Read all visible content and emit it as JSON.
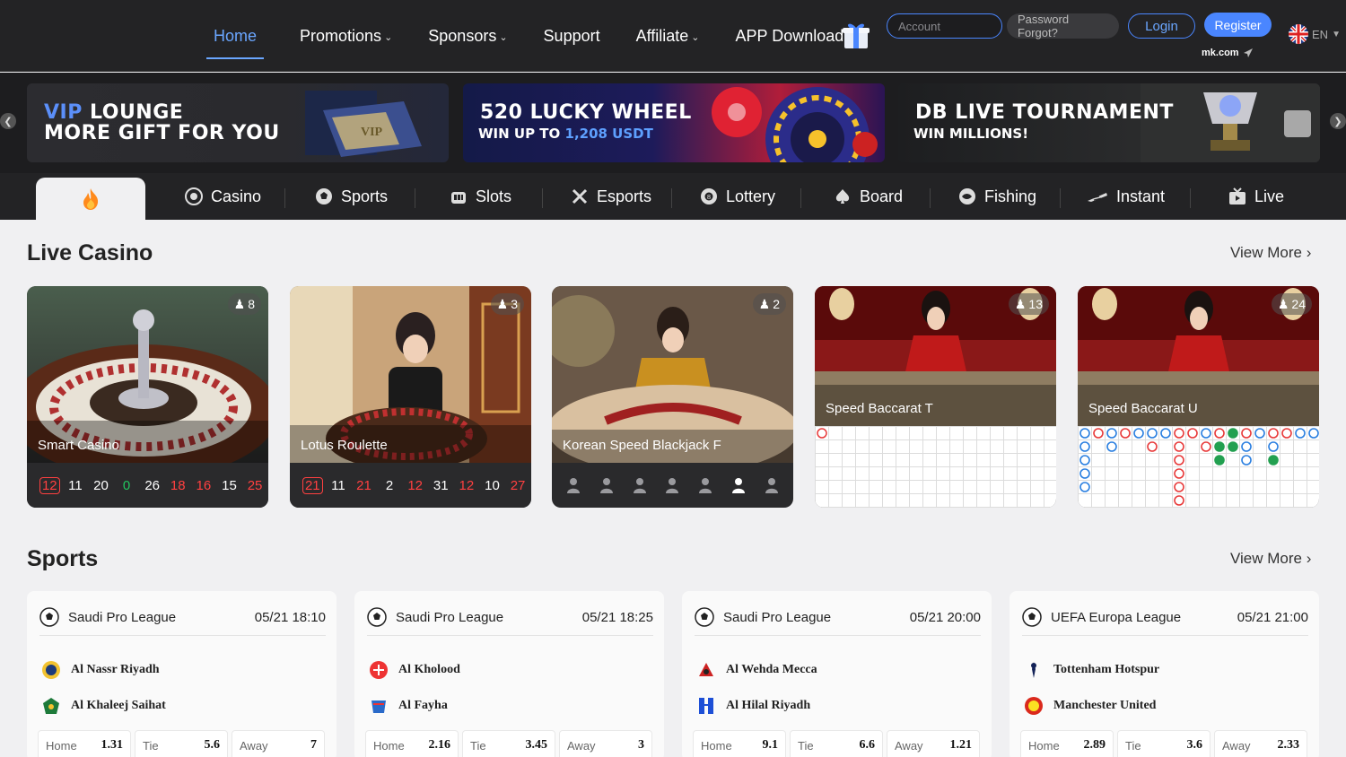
{
  "header": {
    "nav": [
      {
        "label": "Home",
        "active": true,
        "dropdown": false
      },
      {
        "label": "Promotions",
        "dropdown": true
      },
      {
        "label": "Sponsors",
        "dropdown": true
      },
      {
        "label": "Support",
        "dropdown": false
      },
      {
        "label": "Affiliate",
        "dropdown": true
      },
      {
        "label": "APP Download",
        "dropdown": true
      }
    ],
    "account_placeholder": "Account",
    "password_forgot": "Password Forgot?",
    "login": "Login",
    "register": "Register",
    "domain_label": "mk.com",
    "language": "EN"
  },
  "banners": [
    {
      "title_hl": "VIP",
      "title_rest": " LOUNGE",
      "line2": "MORE GIFT FOR YOU",
      "art_text": "VIP"
    },
    {
      "title": "520 LUCKY WHEEL",
      "sub_pre": "WIN UP TO ",
      "sub_hl": "1,208 USDT"
    },
    {
      "title": "DB LIVE TOURNAMENT",
      "sub": "WIN MILLIONS!"
    }
  ],
  "categories": [
    "Casino",
    "Sports",
    "Slots",
    "Esports",
    "Lottery",
    "Board",
    "Fishing",
    "Instant",
    "Live"
  ],
  "live_casino": {
    "title": "Live Casino",
    "view_more": "View More",
    "tables": [
      {
        "name": "Smart Casino",
        "players": "8",
        "results": [
          {
            "v": "12",
            "c": "boxed"
          },
          {
            "v": "11",
            "c": "white"
          },
          {
            "v": "20",
            "c": "white"
          },
          {
            "v": "0",
            "c": "green"
          },
          {
            "v": "26",
            "c": "white"
          },
          {
            "v": "18",
            "c": "red"
          },
          {
            "v": "16",
            "c": "red"
          },
          {
            "v": "15",
            "c": "white"
          },
          {
            "v": "25",
            "c": "red"
          }
        ]
      },
      {
        "name": "Lotus Roulette",
        "players": "3",
        "results": [
          {
            "v": "21",
            "c": "boxed"
          },
          {
            "v": "11",
            "c": "white"
          },
          {
            "v": "21",
            "c": "red"
          },
          {
            "v": "2",
            "c": "white"
          },
          {
            "v": "12",
            "c": "red"
          },
          {
            "v": "31",
            "c": "white"
          },
          {
            "v": "12",
            "c": "red"
          },
          {
            "v": "10",
            "c": "white"
          },
          {
            "v": "27",
            "c": "red"
          }
        ]
      },
      {
        "name": "Korean Speed Blackjack F",
        "players": "2",
        "seats_occupied": [
          6
        ]
      },
      {
        "name": "Speed Baccarat T",
        "players": "13"
      },
      {
        "name": "Speed Baccarat U",
        "players": "24"
      }
    ]
  },
  "sports": {
    "title": "Sports",
    "view_more": "View More",
    "matches": [
      {
        "league": "Saudi Pro League",
        "time": "05/21 18:10",
        "home": "Al Nassr Riyadh",
        "away": "Al Khaleej Saihat",
        "odds": [
          {
            "label": "Home",
            "value": "1.31"
          },
          {
            "label": "Tie",
            "value": "5.6"
          },
          {
            "label": "Away",
            "value": "7"
          }
        ]
      },
      {
        "league": "Saudi Pro League",
        "time": "05/21 18:25",
        "home": "Al Kholood",
        "away": "Al Fayha",
        "odds": [
          {
            "label": "Home",
            "value": "2.16"
          },
          {
            "label": "Tie",
            "value": "3.45"
          },
          {
            "label": "Away",
            "value": "3"
          }
        ]
      },
      {
        "league": "Saudi Pro League",
        "time": "05/21 20:00",
        "home": "Al Wehda Mecca",
        "away": "Al Hilal Riyadh",
        "odds": [
          {
            "label": "Home",
            "value": "9.1"
          },
          {
            "label": "Tie",
            "value": "6.6"
          },
          {
            "label": "Away",
            "value": "1.21"
          }
        ]
      },
      {
        "league": "UEFA Europa League",
        "time": "05/21 21:00",
        "home": "Tottenham Hotspur",
        "away": "Manchester United",
        "odds": [
          {
            "label": "Home",
            "value": "2.89"
          },
          {
            "label": "Tie",
            "value": "3.6"
          },
          {
            "label": "Away",
            "value": "2.33"
          }
        ]
      }
    ]
  },
  "colors": {
    "accent": "#4a86ff",
    "red": "#ff4040",
    "green": "#22c55e",
    "dark": "#232325"
  }
}
